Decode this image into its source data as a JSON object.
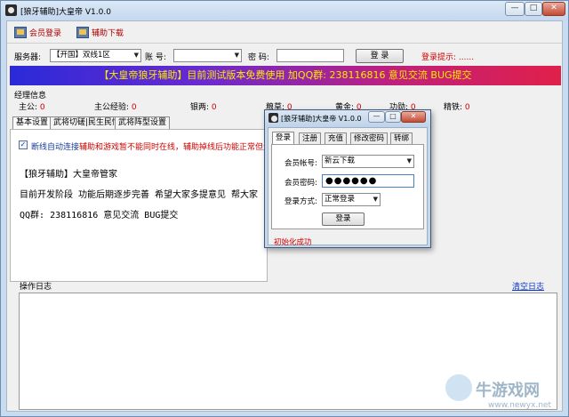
{
  "window": {
    "title": "[狼牙辅助]大皇帝 V1.0.0",
    "controls": [
      "—",
      "□",
      "✕"
    ]
  },
  "toolbar": {
    "member_login": "会员登录",
    "assist_download": "辅助下载"
  },
  "server_row": {
    "server_label": "服务器:",
    "server_value": "【开国】双线1区",
    "account_label": "账 号:",
    "account_value": "",
    "password_label": "密 码:",
    "password_value": "",
    "login_button": "登 录",
    "login_hint": "登录提示: ......"
  },
  "banner": "【大皇帝狼牙辅助】目前测试版本免费使用    加QQ群: 238116816 意见交流 BUG提交",
  "info": {
    "title": "经理信息",
    "items": [
      {
        "label": "主公:",
        "value": "0"
      },
      {
        "label": "主公经验:",
        "value": "0"
      },
      {
        "label": "银两:",
        "value": "0"
      },
      {
        "label": "粮草:",
        "value": "0"
      },
      {
        "label": "黄金:",
        "value": "0"
      },
      {
        "label": "功勋:",
        "value": "0"
      },
      {
        "label": "精铁:",
        "value": "0"
      }
    ]
  },
  "tabs": [
    "基本设置",
    "武将切磋|民生民情",
    "武将阵型设置"
  ],
  "settings": {
    "auto_reconnect_label": "断线自动连接",
    "auto_reconnect_note": "辅助和游戏暂不能同时在线，辅助掉线后功能正常但无法显示"
  },
  "notice": {
    "line1": "【狼牙辅助】大皇帝管家",
    "line2": "目前开发阶段 功能后期逐步完善 希望大家多提意见 帮大家",
    "line3": "QQ群: 238116816 意见交流 BUG提交"
  },
  "log": {
    "title": "操作日志",
    "clear_link": "清空日志"
  },
  "dialog": {
    "title": "[狼牙辅助]大皇帝 V1.0.0",
    "tabs": [
      "登录",
      "注册",
      "充值",
      "修改密码",
      "转绑"
    ],
    "account_label": "会员帐号:",
    "account_value": "新云下载",
    "password_label": "会员密码:",
    "password_value": "●●●●●●",
    "mode_label": "登录方式:",
    "mode_value": "正常登录",
    "login_button": "登录",
    "status": "初始化成功"
  },
  "watermark": {
    "brand": "牛游戏网",
    "url": "www.newyx.net"
  }
}
